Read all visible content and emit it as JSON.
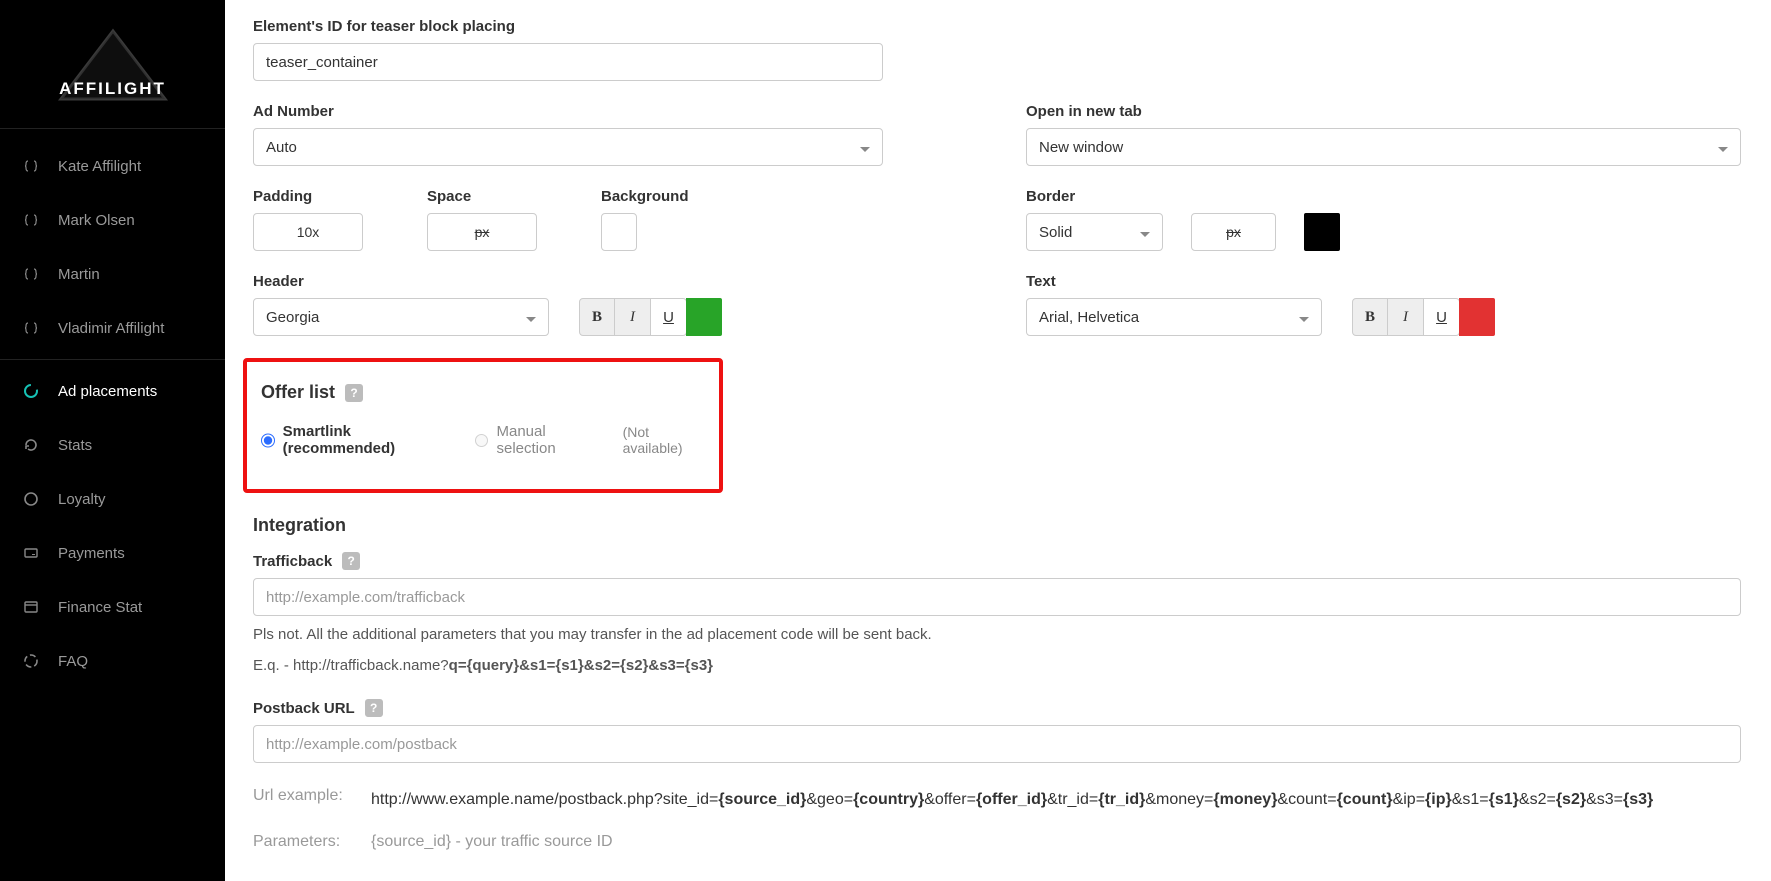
{
  "brand": "AFFILIGHT",
  "sidebar": {
    "items": [
      {
        "label": "Kate Affilight",
        "type": "user"
      },
      {
        "label": "Mark Olsen",
        "type": "user"
      },
      {
        "label": "Martin",
        "type": "user"
      },
      {
        "label": "Vladimir Affilight",
        "type": "user"
      },
      {
        "label": "Ad placements",
        "type": "nav",
        "active": true,
        "icon": "circle-loader"
      },
      {
        "label": "Stats",
        "type": "nav",
        "icon": "refresh"
      },
      {
        "label": "Loyalty",
        "type": "nav",
        "icon": "circle"
      },
      {
        "label": "Payments",
        "type": "nav",
        "icon": "card"
      },
      {
        "label": "Finance Stat",
        "type": "nav",
        "icon": "window"
      },
      {
        "label": "FAQ",
        "type": "nav",
        "icon": "loader-broken"
      }
    ]
  },
  "form": {
    "teaserIdLabel": "Element's ID for teaser block placing",
    "teaserIdValue": "teaser_container",
    "adNumberLabel": "Ad Number",
    "adNumberValue": "Auto",
    "openTabLabel": "Open in new tab",
    "openTabValue": "New window",
    "paddingLabel": "Padding",
    "paddingValue": "10",
    "unitPadding": "10x",
    "spaceLabel": "Space",
    "unitSpace": "px",
    "backgroundLabel": "Background",
    "borderLabel": "Border",
    "borderStyle": "Solid",
    "unitBorder": "px",
    "borderColor": "#000000",
    "headerLabel": "Header",
    "headerFont": "Georgia",
    "headerColor": "#28a428",
    "textLabel": "Text",
    "textFont": "Arial, Helvetica",
    "textColor": "#e23232",
    "boldGlyph": "B",
    "italicGlyph": "I",
    "underGlyph": "U"
  },
  "offer": {
    "title": "Offer list",
    "opt1": "Smartlink (recommended)",
    "opt2": "Manual selection",
    "na": "(Not available)"
  },
  "integration": {
    "title": "Integration",
    "trafficbackLabel": "Trafficback",
    "trafficbackPlaceholder": "http://example.com/trafficback",
    "note1": "Pls not. All the additional parameters that you may transfer in the ad placement code will be sent back.",
    "note2pre": "E.q. - http://trafficback.name?",
    "note2bold": "q={query}&s1={s1}&s2={s2}&s3={s3}",
    "postbackLabel": "Postback URL",
    "postbackPlaceholder": "http://example.com/postback",
    "urlExLabel": "Url example:",
    "urlExText": "http://www.example.name/postback.php?site_id={source_id}&geo={country}&offer={offer_id}&tr_id={tr_id}&money={money}&count={count}&ip={ip}&s1={s1}&s2={s2}&s3={s3}",
    "paramsLabel": "Parameters:",
    "paramsText": "{source_id} - your traffic source ID"
  }
}
